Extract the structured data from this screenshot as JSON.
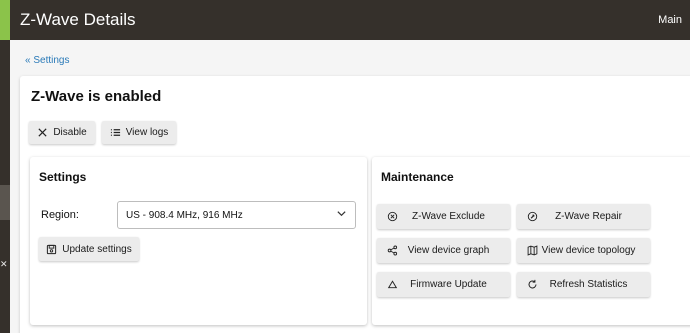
{
  "header": {
    "title": "Z-Wave Details",
    "menu_link": "Main"
  },
  "breadcrumb": "« Settings",
  "main": {
    "status": "Z-Wave is enabled",
    "actions": {
      "disable": "Disable",
      "view_logs": "View logs"
    }
  },
  "settings": {
    "title": "Settings",
    "region_label": "Region:",
    "region_value": "US - 908.4 MHz, 916 MHz",
    "update_button": "Update settings"
  },
  "maintenance": {
    "title": "Maintenance",
    "buttons": {
      "exclude": "Z-Wave Exclude",
      "repair": "Z-Wave Repair",
      "graph": "View device graph",
      "topology": "View device topology",
      "firmware": "Firmware Update",
      "refresh": "Refresh Statistics"
    }
  },
  "colors": {
    "header_bg": "#35302b",
    "accent": "#8bc34a",
    "link": "#2a7ab8",
    "button_bg": "#ececec"
  }
}
